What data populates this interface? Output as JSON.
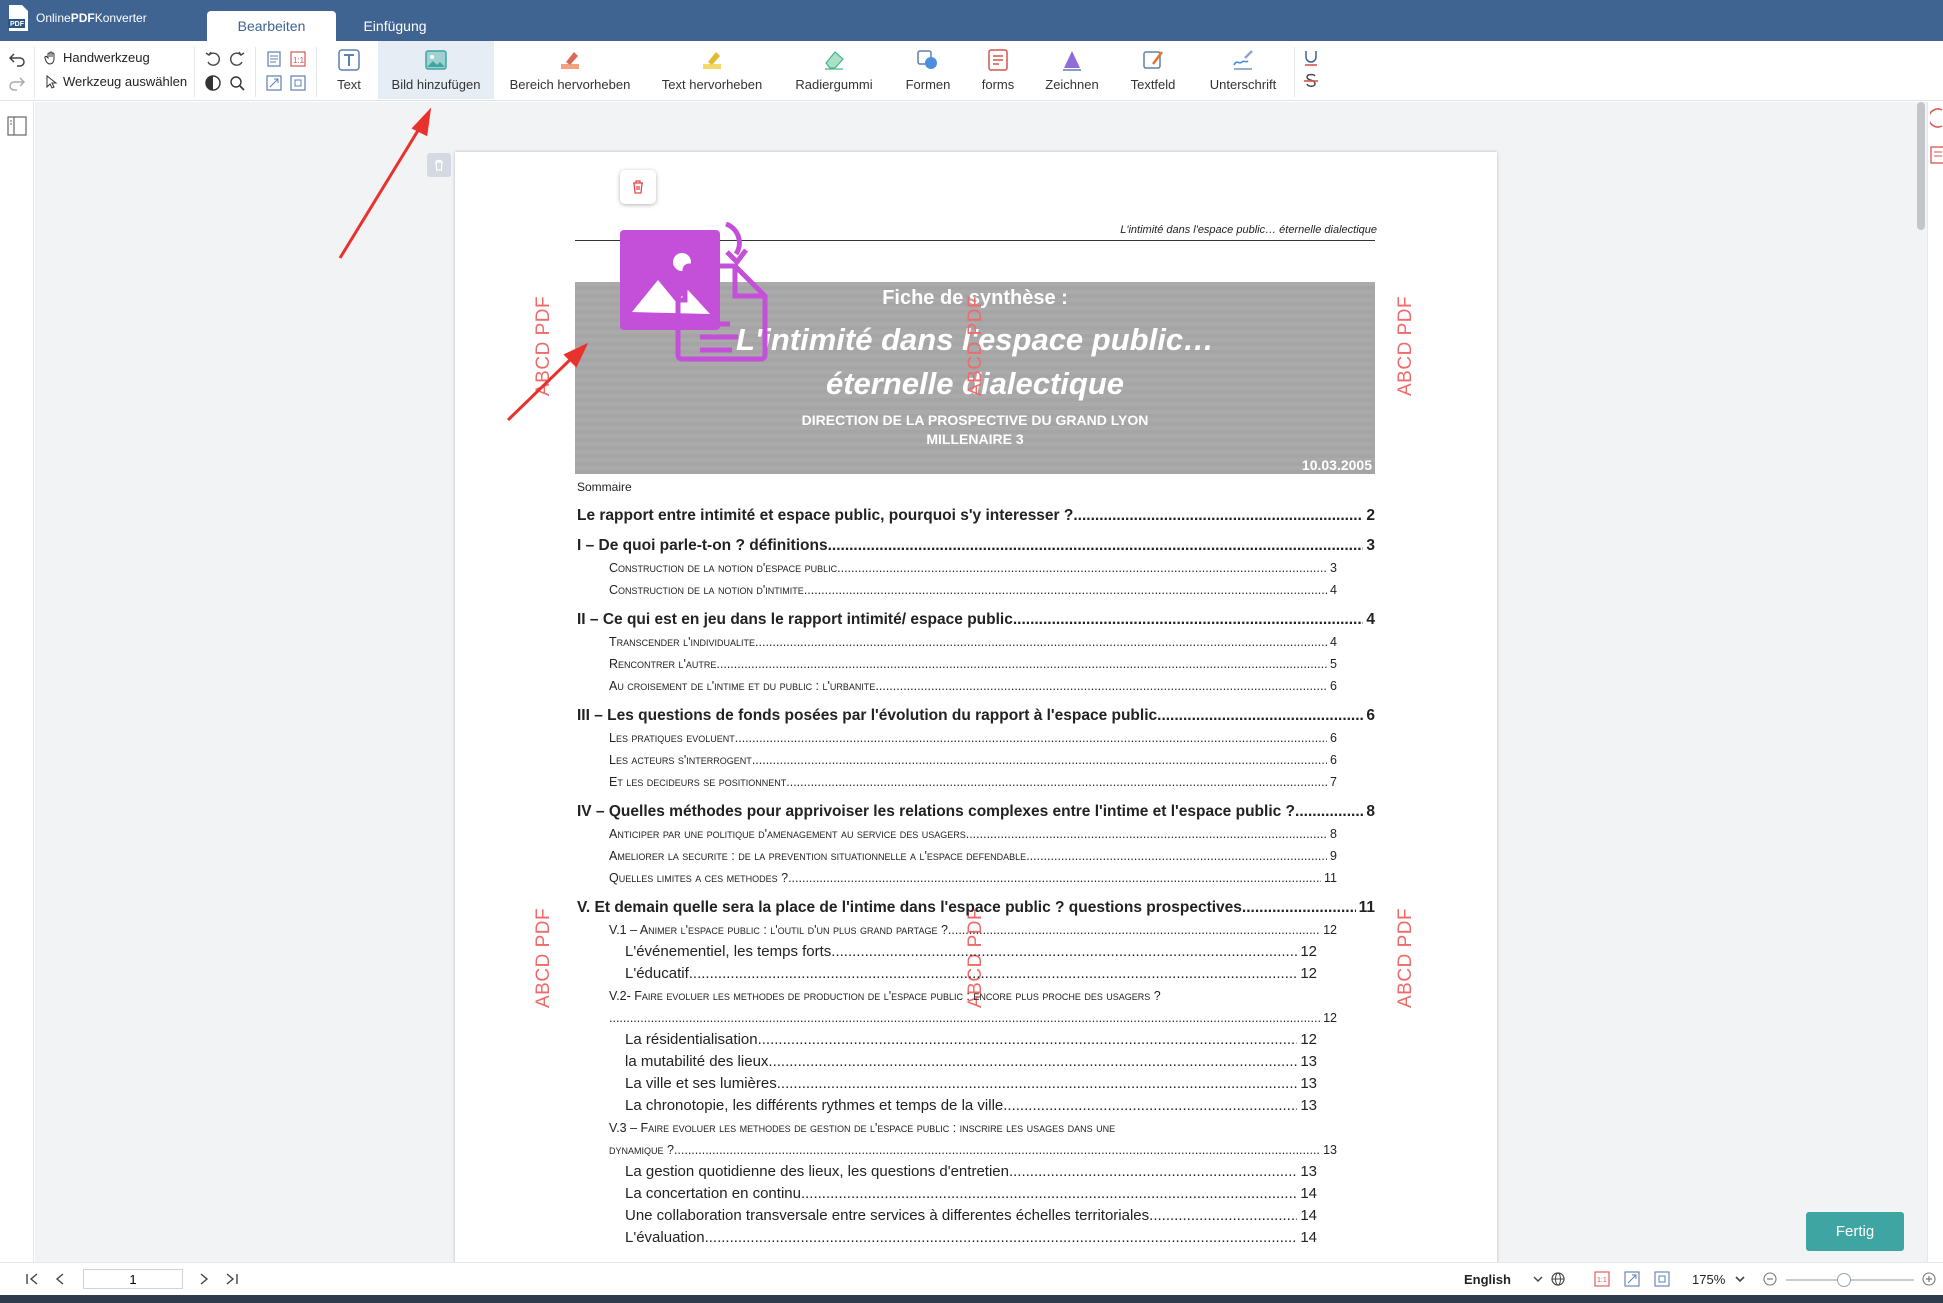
{
  "app": {
    "name_prefix": "Online",
    "name_bold": "PDF",
    "name_suffix": "Konverter"
  },
  "tabs": [
    {
      "label": "Bearbeiten",
      "active": true
    },
    {
      "label": "Einfügung",
      "active": false
    }
  ],
  "toolbar": {
    "hand_tool": "Handwerkzeug",
    "select_tool": "Werkzeug auswählen",
    "buttons": [
      {
        "label": "Text",
        "icon": "text-icon"
      },
      {
        "label": "Bild hinzufügen",
        "icon": "image-icon",
        "active": true
      },
      {
        "label": "Bereich hervorheben",
        "icon": "area-highlight-icon"
      },
      {
        "label": "Text hervorheben",
        "icon": "text-highlight-icon"
      },
      {
        "label": "Radiergummi",
        "icon": "eraser-icon"
      },
      {
        "label": "Formen",
        "icon": "shapes-icon"
      },
      {
        "label": "forms",
        "icon": "forms-icon"
      },
      {
        "label": "Zeichnen",
        "icon": "draw-icon"
      },
      {
        "label": "Textfeld",
        "icon": "textfield-icon"
      },
      {
        "label": "Unterschrift",
        "icon": "signature-icon"
      }
    ]
  },
  "document": {
    "running_header": "L'intimité dans l'espace public… éternelle dialectique",
    "banner": {
      "label": "Fiche de synthèse :",
      "title_line1": "L'intimité dans l'espace public…",
      "title_line2": "éternelle dialectique",
      "org_line1": "DIRECTION DE LA PROSPECTIVE DU GRAND LYON",
      "org_line2": "MILLENAIRE 3",
      "date": "10.03.2005"
    },
    "watermark": "ABCD PDF",
    "sommaire": "Sommaire",
    "toc": [
      {
        "type": "h",
        "label": "Le rapport entre intimité et espace public, pourquoi s'y interesser ?",
        "page": "2"
      },
      {
        "type": "h",
        "label": "I – De quoi parle-t-on ? définitions",
        "page": "3"
      },
      {
        "type": "s",
        "label": "Construction de la notion d'espace public",
        "page": "3"
      },
      {
        "type": "s",
        "label": "Construction de la notion d'intimite",
        "page": "4"
      },
      {
        "type": "h",
        "label": "II – Ce qui est en jeu dans le rapport intimité/ espace public",
        "page": "4"
      },
      {
        "type": "s",
        "label": "Transcender l'individualite",
        "page": "4"
      },
      {
        "type": "s",
        "label": "Rencontrer l'autre",
        "page": "5"
      },
      {
        "type": "s",
        "label": "Au croisement de l'intime et du public : l'urbanite",
        "page": "6"
      },
      {
        "type": "h",
        "label": "III – Les questions de fonds posées par l'évolution du rapport à l'espace public",
        "page": "6"
      },
      {
        "type": "s",
        "label": "Les pratiques evoluent",
        "page": "6"
      },
      {
        "type": "s",
        "label": "Les acteurs s'interrogent",
        "page": "6"
      },
      {
        "type": "s",
        "label": "Et les decideurs se positionnent",
        "page": "7"
      },
      {
        "type": "h",
        "label": "IV – Quelles méthodes pour apprivoiser les relations complexes entre l'intime et l'espace public ?",
        "page": "8"
      },
      {
        "type": "s",
        "label": "Anticiper par une politique d'amenagement au service des usagers",
        "page": "8"
      },
      {
        "type": "s",
        "label": "Ameliorer la securite : de la prevention situationnelle a l'espace defendable",
        "page": "9"
      },
      {
        "type": "s",
        "label": "Quelles limites a ces methodes ?",
        "page": "11"
      },
      {
        "type": "h",
        "label": "V. Et demain quelle sera la place de l'intime dans l'espace public ? questions prospectives",
        "page": "11"
      },
      {
        "type": "s",
        "label": "V.1 – Animer l'espace public : l'outil d'un plus grand partage ?",
        "page": "12"
      },
      {
        "type": "s2",
        "label": "L'événementiel, les temps forts",
        "page": "12"
      },
      {
        "type": "s2",
        "label": "L'éducatif",
        "page": "12"
      },
      {
        "type": "line",
        "label": "V.2- Faire evoluer les methodes de production de l'espace public : encore plus proche des usagers ?"
      },
      {
        "type": "s",
        "label": "",
        "page": "12"
      },
      {
        "type": "s2",
        "label": "La résidentialisation",
        "page": "12"
      },
      {
        "type": "s2",
        "label": "la mutabilité des lieux",
        "page": "13"
      },
      {
        "type": "s2",
        "label": "La ville et ses lumières",
        "page": "13"
      },
      {
        "type": "s2",
        "label": "La chronotopie, les différents rythmes et temps de la ville",
        "page": "13"
      },
      {
        "type": "line",
        "label": "V.3 – Faire evoluer les methodes de gestion de l'espace public : inscrire les usages dans une"
      },
      {
        "type": "s",
        "label": "dynamique ?",
        "page": "13"
      },
      {
        "type": "s2",
        "label": "La gestion quotidienne des lieux, les questions d'entretien",
        "page": "13"
      },
      {
        "type": "s2",
        "label": "La concertation en continu",
        "page": "14"
      },
      {
        "type": "s2",
        "label": "Une collaboration transversale entre services à differentes échelles territoriales",
        "page": "14"
      },
      {
        "type": "s2",
        "label": "L'évaluation",
        "page": "14"
      }
    ]
  },
  "footer": {
    "page_value": "1",
    "language": "English",
    "zoom": "175%",
    "zoom_fraction": 0.45,
    "done_label": "Fertig"
  },
  "colors": {
    "titlebar": "#3f6491",
    "accent": "#3fa5a2",
    "watermark": "#f06a6a",
    "image_overlay": "#c44fd9",
    "annotation_arrow": "#e8322e"
  }
}
